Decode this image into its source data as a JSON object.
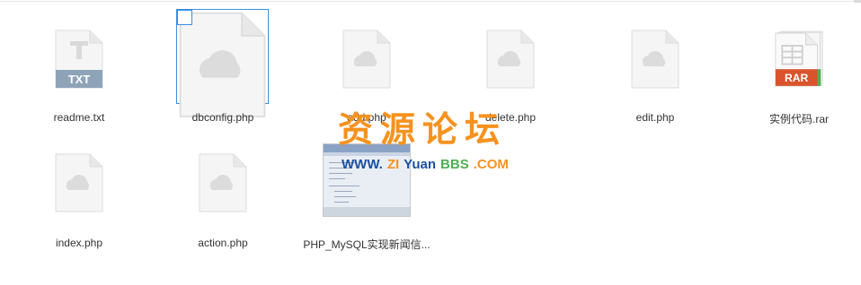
{
  "files": [
    {
      "name": "readme.txt",
      "type": "TXT"
    },
    {
      "name": "dbconfig.php",
      "type": "php",
      "selected": true
    },
    {
      "name": "add.php",
      "type": "php"
    },
    {
      "name": "delete.php",
      "type": "php"
    },
    {
      "name": "edit.php",
      "type": "php"
    },
    {
      "name": "实例代码.rar",
      "type": "RAR"
    },
    {
      "name": "index.php",
      "type": "php"
    },
    {
      "name": "action.php",
      "type": "php"
    },
    {
      "name": "PHP_MySQL实现新闻信...",
      "type": "image"
    }
  ],
  "overlay": {
    "text_cn": "资源论坛",
    "url_www": "WWW.",
    "url_zi": "ZI",
    "url_yuan": "Yuan",
    "url_bbs": "BBS",
    "url_com": ".COM"
  },
  "colors": {
    "select_border": "#3c8ce7",
    "txt_badge": "#8fa3b8",
    "rar_badge": "#d9542c",
    "watermark_orange": "#f6921e",
    "watermark_blue": "#1b4fa0",
    "watermark_green": "#4caf50"
  }
}
